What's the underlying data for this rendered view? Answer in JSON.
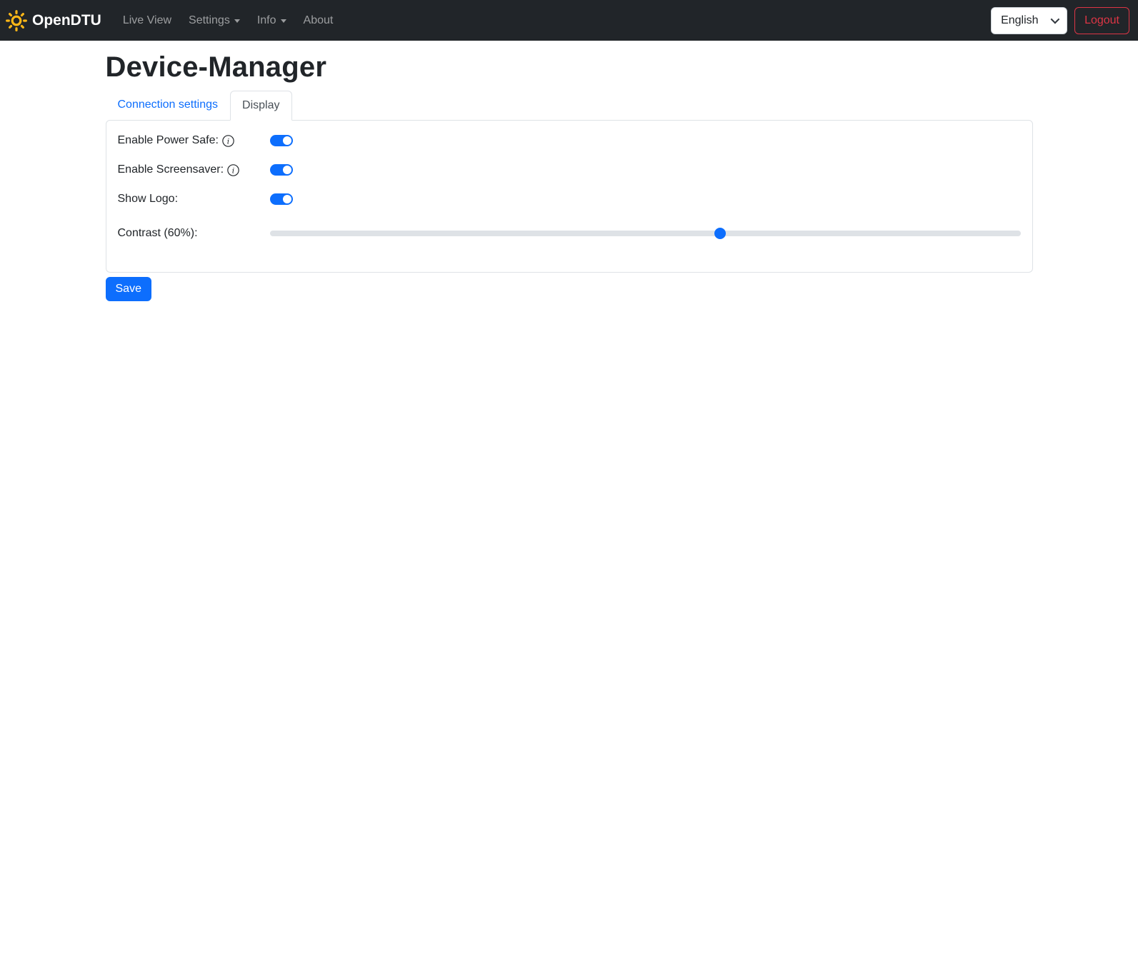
{
  "navbar": {
    "brand": "OpenDTU",
    "items": [
      {
        "label": "Live View",
        "has_dropdown": false
      },
      {
        "label": "Settings",
        "has_dropdown": true
      },
      {
        "label": "Info",
        "has_dropdown": true
      },
      {
        "label": "About",
        "has_dropdown": false
      }
    ],
    "language_selector": {
      "value": "English"
    },
    "logout_label": "Logout"
  },
  "page": {
    "title": "Device-Manager"
  },
  "tabs": [
    {
      "label": "Connection settings",
      "active": false
    },
    {
      "label": "Display",
      "active": true
    }
  ],
  "form": {
    "rows": [
      {
        "label": "Enable Power Safe:",
        "has_info": true,
        "type": "switch",
        "value": true
      },
      {
        "label": "Enable Screensaver:",
        "has_info": true,
        "type": "switch",
        "value": true
      },
      {
        "label": "Show Logo:",
        "has_info": false,
        "type": "switch",
        "value": true
      },
      {
        "label": "Contrast (60%):",
        "has_info": false,
        "type": "slider",
        "value": 60
      }
    ],
    "save_label": "Save"
  },
  "colors": {
    "primary": "#0d6efd",
    "danger": "#dc3545",
    "navbar_bg": "#212529",
    "brand_icon": "#fdb717",
    "border": "#dee2e6"
  }
}
